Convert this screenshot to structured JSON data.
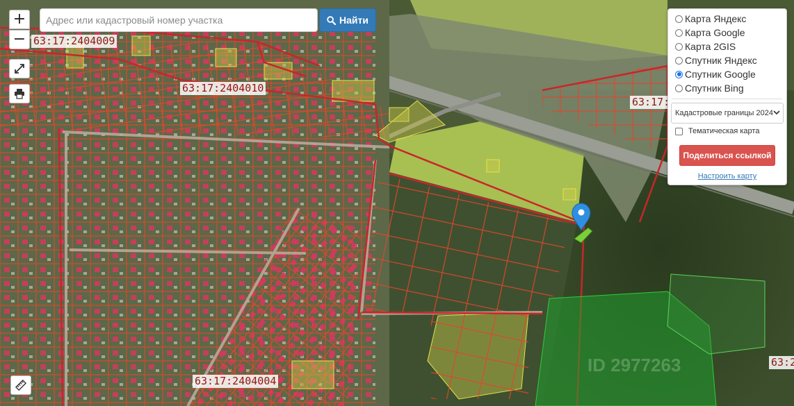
{
  "search": {
    "placeholder": "Адрес или кадастровый номер участка",
    "button_label": "Найти",
    "button_icon": "search-icon"
  },
  "controls": {
    "zoom_in_label": "+",
    "zoom_out_label": "−",
    "fullscreen_icon": "expand-icon",
    "print_icon": "printer-icon",
    "ruler_icon": "ruler-icon"
  },
  "panel": {
    "layers": [
      {
        "label": "Карта Яндекс",
        "checked": false
      },
      {
        "label": "Карта Google",
        "checked": false
      },
      {
        "label": "Карта 2GIS",
        "checked": false
      },
      {
        "label": "Спутник Яндекс",
        "checked": false
      },
      {
        "label": "Спутник Google",
        "checked": true
      },
      {
        "label": "Спутник Bing",
        "checked": false
      }
    ],
    "borders_select_value": "Кадастровые границы 2024",
    "thematic_label": "Тематическая карта",
    "share_button_label": "Поделиться ссылкой",
    "configure_link": "Настроить карту"
  },
  "map": {
    "labels": [
      "63:17:2404009",
      "63:17:2404010",
      "63:17:",
      "63:17:2404004",
      "63:2"
    ],
    "watermark": "ID 2977263",
    "colors": {
      "parcel_border": "#e03a24",
      "quarter_border": "#c8262a",
      "selected_parcel": "#7dcf3a",
      "marker": "#2f8fe0",
      "highlight_green": "#1e9e2e"
    }
  }
}
